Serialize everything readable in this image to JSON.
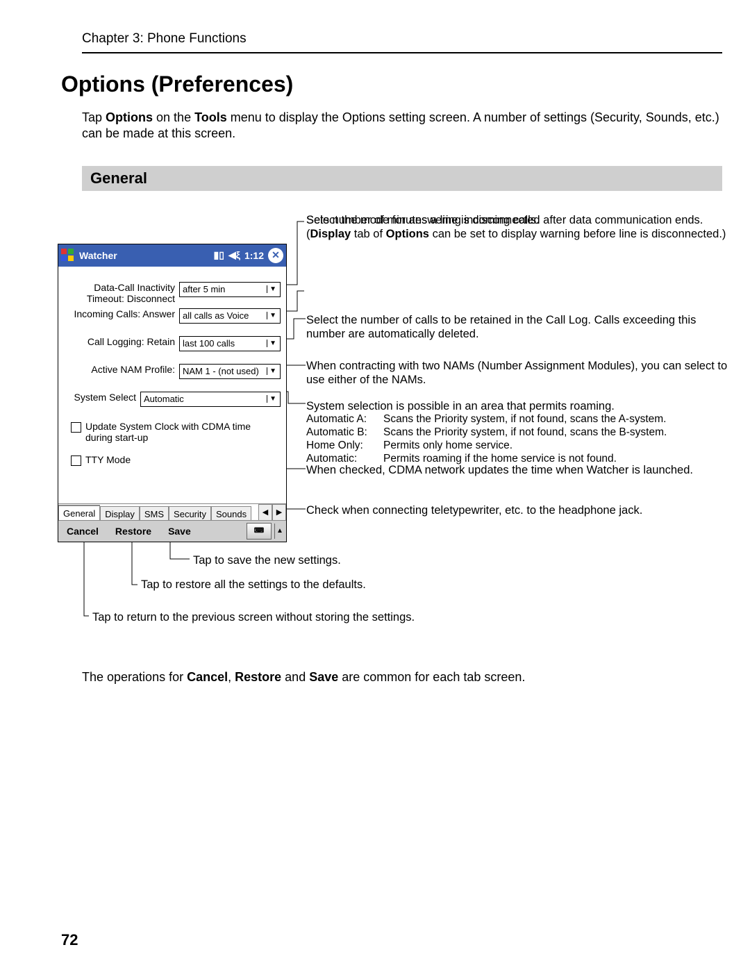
{
  "header": {
    "chapter": "Chapter 3: Phone Functions"
  },
  "title": "Options (Preferences)",
  "intro": {
    "pre": "Tap ",
    "b1": "Options",
    "mid1": " on the ",
    "b2": "Tools",
    "mid2": " menu to display the Options setting screen. A number of settings (Security, Sounds, etc.) can be made at this screen."
  },
  "section": "General",
  "phone": {
    "title": "Watcher",
    "time": "1:12",
    "rows": {
      "inactivity": {
        "label": "Data-Call Inactivity Timeout: Disconnect",
        "value": "after 5 min"
      },
      "incoming": {
        "label": "Incoming Calls: Answer",
        "value": "all calls as Voice"
      },
      "logging": {
        "label": "Call Logging: Retain",
        "value": "last 100 calls"
      },
      "nam": {
        "label": "Active NAM Profile:",
        "value": "NAM 1 - (not used)"
      },
      "system": {
        "label": "System Select",
        "value": "Automatic"
      }
    },
    "chk_clock": "Update System Clock with CDMA time during start-up",
    "chk_tty": "TTY Mode",
    "tabs": {
      "general": "General",
      "display": "Display",
      "sms": "SMS",
      "security": "Security",
      "sounds": "Sounds"
    },
    "bottom": {
      "cancel": "Cancel",
      "restore": "Restore",
      "save": "Save"
    }
  },
  "callouts": {
    "c1a": "Sets number of minutes a line is disconnected after data communication ends.",
    "c1b_pre": "(",
    "c1b_b1": "Display",
    "c1b_mid": " tab of ",
    "c1b_b2": "Options",
    "c1b_post": " can be set to display warning before line is disconnected.)",
    "c2": "Select the mode for answering incoming calls.",
    "c3": "Select the number of calls to be retained in the Call Log. Calls exceeding this number are automatically deleted.",
    "c4": "When contracting with two NAMs (Number Assignment Modules), you can select to use either of the NAMs.",
    "c5": "System selection is possible in an area that permits roaming.",
    "c5a_l": "Automatic A:",
    "c5a_r": "Scans the Priority system, if not found, scans the A-system.",
    "c5b_l": "Automatic B:",
    "c5b_r": "Scans the Priority system, if not found, scans the B-system.",
    "c5c_l": "Home Only:",
    "c5c_r": "Permits only home service.",
    "c5d_l": "Automatic:",
    "c5d_r": "Permits roaming if the home service is not found.",
    "c6": "When checked, CDMA network updates the time when Watcher is launched.",
    "c7": "Check when connecting teletypewriter, etc. to the headphone jack.",
    "save": "Tap to save the new settings.",
    "restore": "Tap to restore all the settings to the defaults.",
    "cancel": "Tap to return to the previous screen without storing the settings."
  },
  "foot": {
    "pre": "The operations for ",
    "b1": "Cancel",
    "c1": ", ",
    "b2": "Restore",
    "c2": " and ",
    "b3": "Save",
    "post": " are common for each tab screen."
  },
  "page_number": "72"
}
